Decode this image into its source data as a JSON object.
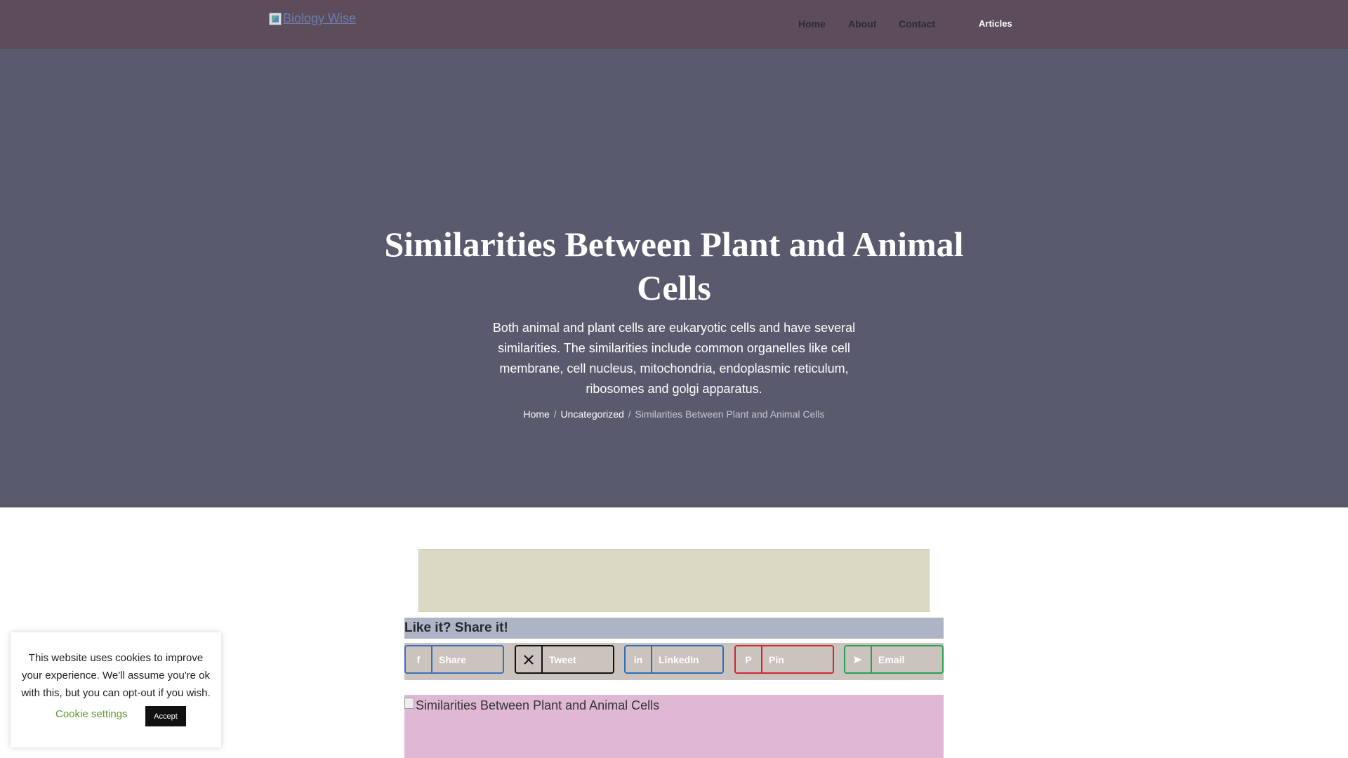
{
  "header": {
    "logo_alt": "Biology Wise",
    "nav": [
      {
        "label": "Home"
      },
      {
        "label": "About"
      },
      {
        "label": "Contact"
      },
      {
        "label": "Articles"
      }
    ]
  },
  "hero": {
    "title": "Similarities Between Plant and Animal Cells",
    "description": "Both animal and plant cells are eukaryotic cells and have several similarities. The similarities include common organelles like cell membrane, cell nucleus, mitochondria, endoplasmic reticulum, ribosomes and golgi apparatus.",
    "breadcrumb": {
      "home": "Home",
      "category": "Uncategorized",
      "current": "Similarities Between Plant and Animal Cells",
      "separator": "/"
    }
  },
  "share": {
    "title": "Like it? Share it!",
    "buttons": [
      {
        "label": "Share",
        "icon": "facebook-icon"
      },
      {
        "label": "Tweet",
        "icon": "x-icon"
      },
      {
        "label": "LinkedIn",
        "icon": "linkedin-icon"
      },
      {
        "label": "Pin",
        "icon": "pinterest-icon"
      },
      {
        "label": "Email",
        "icon": "email-icon"
      }
    ]
  },
  "feature_image": {
    "alt": "Similarities Between Plant and Animal Cells"
  },
  "cookie": {
    "text": "This website uses cookies to improve your experience. We'll assume you're ok with this, but you can opt-out if you wish.",
    "settings_label": "Cookie settings",
    "accept_label": "Accept"
  },
  "colors": {
    "header_bg": "#5d4c5a",
    "hero_bg": "#595a6d",
    "facebook": "#3b6fb8",
    "x": "#111111",
    "linkedin": "#2a6ebb",
    "pinterest": "#d0262f",
    "email": "#26a152",
    "cookie_link": "#5f9b2f"
  }
}
